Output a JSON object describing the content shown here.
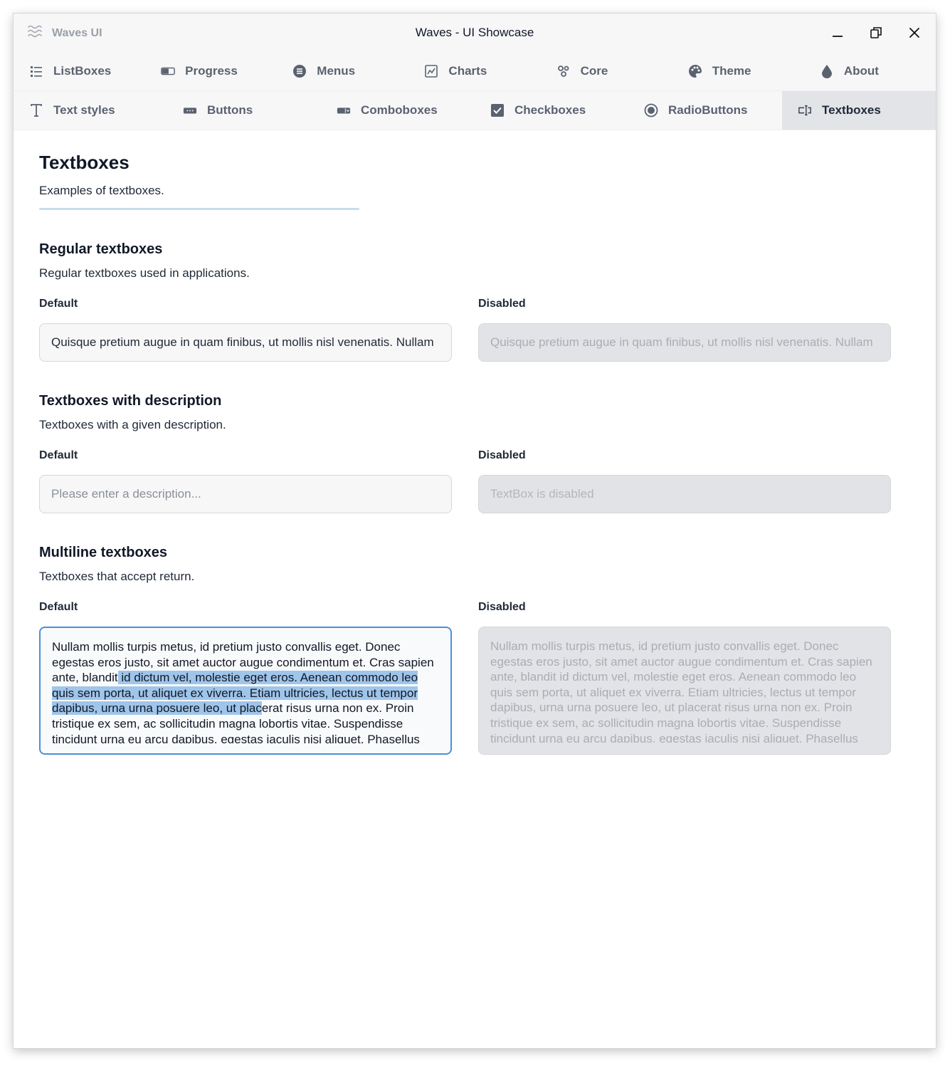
{
  "titlebar": {
    "app_name": "Waves UI",
    "window_title": "Waves - UI Showcase"
  },
  "tabs_row1": [
    {
      "label": "ListBoxes",
      "icon": "list-icon"
    },
    {
      "label": "Progress",
      "icon": "progress-icon"
    },
    {
      "label": "Menus",
      "icon": "menu-icon"
    },
    {
      "label": "Charts",
      "icon": "chart-icon"
    },
    {
      "label": "Core",
      "icon": "core-icon"
    },
    {
      "label": "Theme",
      "icon": "palette-icon"
    },
    {
      "label": "About",
      "icon": "drop-icon"
    }
  ],
  "tabs_row2": [
    {
      "label": "Text styles",
      "icon": "text-icon"
    },
    {
      "label": "Buttons",
      "icon": "button-icon"
    },
    {
      "label": "Comboboxes",
      "icon": "combobox-icon"
    },
    {
      "label": "Checkboxes",
      "icon": "checkbox-icon"
    },
    {
      "label": "RadioButtons",
      "icon": "radio-icon"
    },
    {
      "label": "Textboxes",
      "icon": "textbox-icon",
      "active": true
    }
  ],
  "page": {
    "title": "Textboxes",
    "subtitle": "Examples of textboxes."
  },
  "sections": {
    "regular": {
      "title": "Regular textboxes",
      "subtitle": "Regular textboxes used in applications.",
      "default_label": "Default",
      "disabled_label": "Disabled",
      "default_value": "Quisque pretium augue in quam finibus, ut mollis nisl venenatis. Nullam",
      "disabled_value": "Quisque pretium augue in quam finibus, ut mollis nisl venenatis. Nullam"
    },
    "description": {
      "title": "Textboxes with description",
      "subtitle": "Textboxes with a given description.",
      "default_label": "Default",
      "disabled_label": "Disabled",
      "default_placeholder": "Please enter a description...",
      "disabled_placeholder": "TextBox is disabled"
    },
    "multiline": {
      "title": "Multiline textboxes",
      "subtitle": "Textboxes that accept return.",
      "default_label": "Default",
      "disabled_label": "Disabled",
      "text_before": "Nullam mollis turpis metus, id pretium justo convallis eget. Donec egestas eros justo, sit amet auctor augue condimentum et. Cras sapien ante, blandit",
      "text_selected": " id dictum vel, molestie eget eros. Aenean commodo leo quis sem porta, ut aliquet ex viverra. Etiam ultricies, lectus ut tempor dapibus, urna urna posuere leo, ut plac",
      "text_after": "erat risus urna non ex. Proin tristique ex sem, ac sollicitudin magna lobortis vitae. Suspendisse tincidunt urna eu arcu dapibus, egestas iaculis nisi aliquet. Phasellus",
      "disabled_text": "Nullam mollis turpis metus, id pretium justo convallis eget. Donec egestas eros justo, sit amet auctor augue condimentum et. Cras sapien ante, blandit id dictum vel, molestie eget eros. Aenean commodo leo quis sem porta, ut aliquet ex viverra. Etiam ultricies, lectus ut tempor dapibus, urna urna posuere leo, ut placerat risus urna non ex. Proin tristique ex sem, ac sollicitudin magna lobortis vitae. Suspendisse tincidunt urna eu arcu dapibus, egestas iaculis nisi aliquet. Phasellus"
    }
  },
  "colors": {
    "accent": "#4a90d9",
    "selection": "#9fc5ea",
    "divider": "#c7dde9"
  }
}
